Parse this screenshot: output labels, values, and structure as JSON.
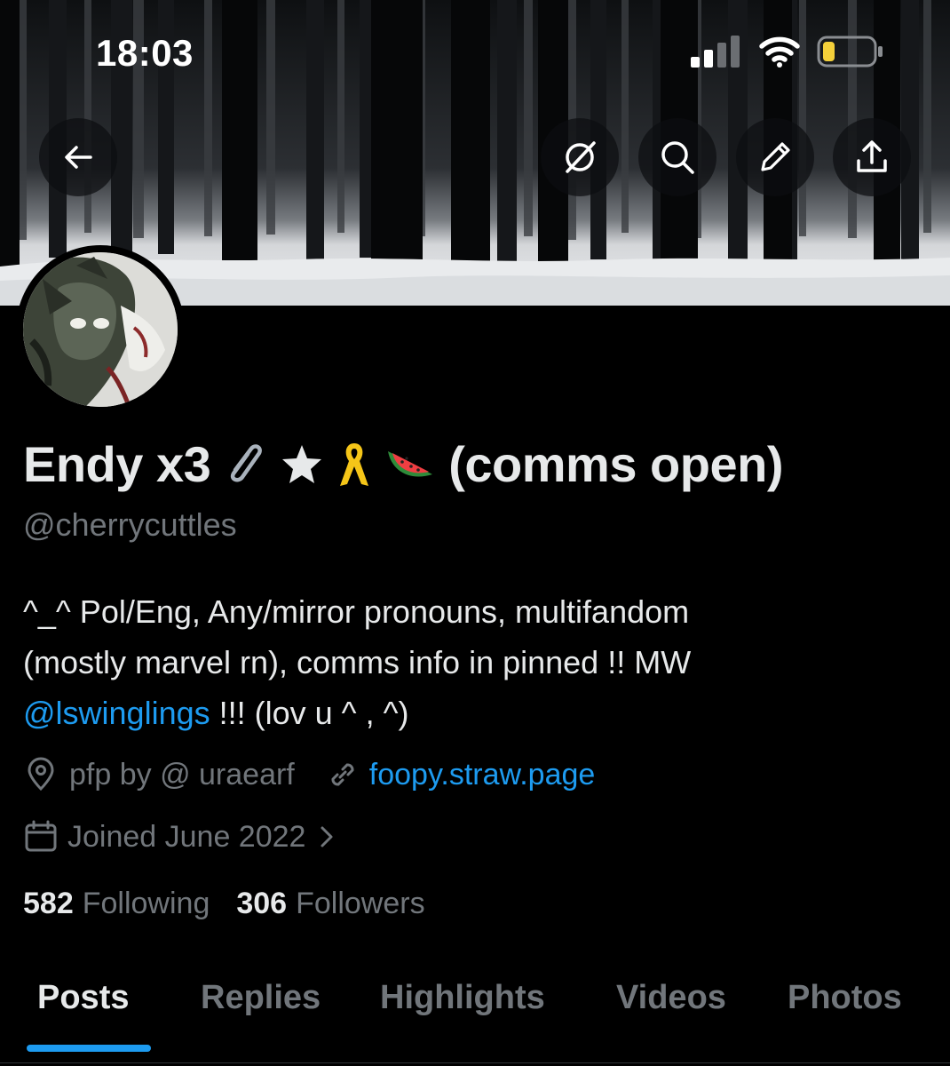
{
  "status_bar": {
    "time": "18:03"
  },
  "icons": {
    "back": "arrow-left-icon",
    "grok": "grok-icon",
    "search": "search-icon",
    "edit": "pencil-icon",
    "share": "share-icon",
    "location": "location-pin-icon",
    "link": "link-icon",
    "calendar": "calendar-icon",
    "chevron": "chevron-right-icon"
  },
  "profile": {
    "name": "Endy x3",
    "name_suffix": "(comms open)",
    "emojis": [
      "paperclip",
      "star",
      "yellow-ribbon",
      "watermelon"
    ],
    "handle": "@cherrycuttles",
    "bio_line1": "^_^ Pol/Eng, Any/mirror pronouns, multifandom",
    "bio_line2": "(mostly marvel rn), comms info in pinned !! MW",
    "bio_mention": "@lswinglings",
    "bio_line3_rest": " !!! (lov u ^ , ^)",
    "location": "pfp by @ uraearf",
    "website": "foopy.straw.page",
    "joined": "Joined June 2022",
    "following_count": "582",
    "following_label": "Following",
    "followers_count": "306",
    "followers_label": "Followers"
  },
  "tabs": [
    "Posts",
    "Replies",
    "Highlights",
    "Videos",
    "Photos"
  ],
  "active_tab": "Posts",
  "colors": {
    "accent": "#1d9bf0",
    "muted": "#71767b",
    "text": "#e7e9ea",
    "background": "#000000"
  }
}
